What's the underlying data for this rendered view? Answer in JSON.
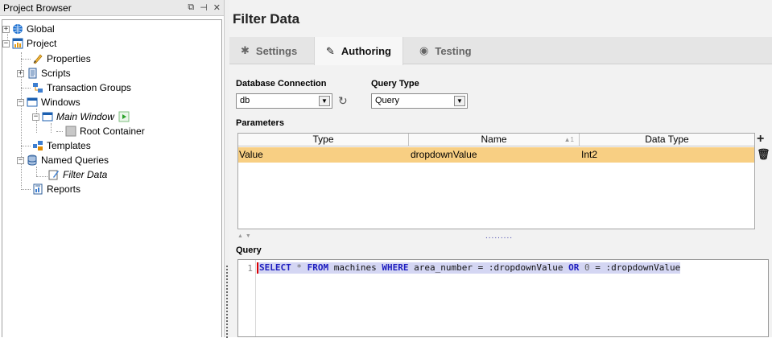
{
  "project_browser": {
    "title": "Project Browser",
    "controls": [
      "⧉",
      "⊣",
      "✕"
    ],
    "nodes": {
      "global": "Global",
      "project": "Project",
      "properties": "Properties",
      "scripts": "Scripts",
      "transaction_groups": "Transaction Groups",
      "windows": "Windows",
      "main_window": "Main Window",
      "root_container": "Root Container",
      "templates": "Templates",
      "named_queries": "Named Queries",
      "filter_data": "Filter Data",
      "reports": "Reports"
    }
  },
  "editor": {
    "title": "Filter Data",
    "tabs": [
      {
        "label": "Settings",
        "icon": "gear-icon"
      },
      {
        "label": "Authoring",
        "icon": "pencil-icon"
      },
      {
        "label": "Testing",
        "icon": "eye-icon"
      }
    ],
    "active_tab": "Authoring",
    "database_connection": {
      "label": "Database Connection",
      "value": "db"
    },
    "query_type": {
      "label": "Query Type",
      "value": "Query"
    },
    "parameters": {
      "label": "Parameters",
      "columns": [
        "Type",
        "Name",
        "Data Type"
      ],
      "sort_indicator": "1",
      "rows": [
        {
          "type": "Value",
          "name": "dropdownValue",
          "data_type": "Int2"
        }
      ],
      "add_symbol": "+",
      "delete_symbol": "🗑"
    },
    "divider_dots": ".........",
    "query": {
      "label": "Query",
      "line_number": "1",
      "tokens": {
        "select": "SELECT",
        "star": " * ",
        "from": "FROM",
        "table": " machines ",
        "where": "WHERE",
        "cond1": " area_number = :dropdownValue ",
        "or": "OR",
        "zero": " 0",
        "cond2": " = :dropdownValue"
      }
    }
  }
}
